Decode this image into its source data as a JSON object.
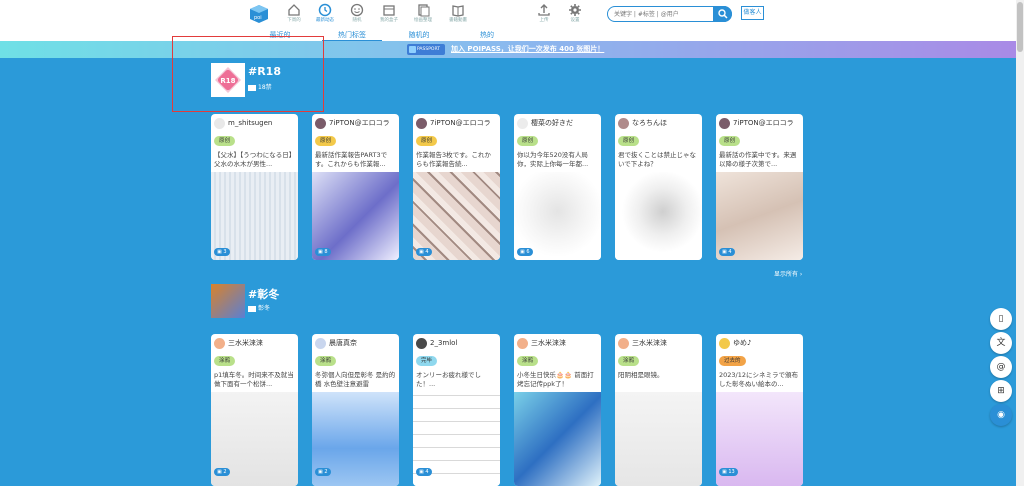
{
  "nav": {
    "items": [
      {
        "label": "下周的",
        "icon": "home-icon",
        "active": false
      },
      {
        "label": "最新动态",
        "icon": "clock-icon",
        "active": true
      },
      {
        "label": "随机",
        "icon": "smile-icon",
        "active": false
      },
      {
        "label": "我的盒子",
        "icon": "box-icon",
        "active": false
      },
      {
        "label": "绘画整理",
        "icon": "pages-icon",
        "active": false
      },
      {
        "label": "書籍動畫",
        "icon": "book-icon",
        "active": false
      },
      {
        "label": "上传",
        "icon": "upload-icon",
        "active": false
      },
      {
        "label": "设置",
        "icon": "gear-icon",
        "active": false
      }
    ],
    "search_placeholder": "关键字 | #标签 | @用户",
    "login_label": "做客人"
  },
  "tabs": [
    "最近的",
    "热门标签",
    "随机的",
    "热的"
  ],
  "banner": {
    "badge": "PASSPORT",
    "link": "加入 POIPASS，让我们一次发布 400 张图片！"
  },
  "sections": [
    {
      "title": "#R18",
      "sub": "18禁",
      "cards": [
        {
          "user": "m_shitsugen",
          "badge": "原创",
          "caption": "【父水】【うつわになる日】父水の水木が男性...",
          "count": "3"
        },
        {
          "user": "7iPTON@エロコラ",
          "badge": "原创",
          "caption": "最新話作業報告PART3です。これからも作業報...",
          "count": "8"
        },
        {
          "user": "7iPTON@エロコラ",
          "badge": "原创",
          "caption": "作業報告3枚です。これからも作業報告続...",
          "count": "4"
        },
        {
          "user": "樱菜の好きだ",
          "badge": "原创",
          "caption": "你以为今年520没有人局你，实际上你每一年都...",
          "count": "6"
        },
        {
          "user": "なろちんほ",
          "badge": "原创",
          "caption": "君で抜くことは禁止じゃないで下よね？",
          "count": ""
        },
        {
          "user": "7iPTON@エロコラ",
          "badge": "原创",
          "caption": "最新話の作業中です。来週以降の様子次第で...",
          "count": "4"
        }
      ]
    },
    {
      "title": "#彰冬",
      "sub": "彰冬",
      "cards": [
        {
          "user": "三水米涞涞",
          "badge": "涂鸦",
          "caption": "p1填车冬。时间来不及就当做下面有一个松饼...",
          "count": "2"
        },
        {
          "user": "晨唐真奈",
          "badge": "涂鸦",
          "caption": "冬弥個人向但是彰冬 是約的橋 水色壁注意避雷",
          "count": "2"
        },
        {
          "user": "2_3mlol",
          "badge": "完毕",
          "caption": "オンリーお疲れ様でした！...",
          "count": "4"
        },
        {
          "user": "三水米涞涞",
          "badge": "涂鸦",
          "caption": "小冬生日快乐🎂🎂 前面打烤忘记传ppk了！",
          "count": ""
        },
        {
          "user": "三水米涞涞",
          "badge": "涂鸦",
          "caption": "阳阴相是眼镜。",
          "count": ""
        },
        {
          "user": "ゆめ♪",
          "badge": "过去的",
          "caption": "2023/12にシネミラで頒布した彰冬ぬい絵本の...",
          "count": "13"
        }
      ]
    }
  ],
  "show_all": "显示所有 ›",
  "float_buttons": [
    "book-icon",
    "translate-icon",
    "at-icon",
    "grid-icon",
    "robot-icon"
  ],
  "colors": {
    "accent": "#2a8fd6",
    "page_bg": "#2b9ad9",
    "badge_green": "#b9e08a",
    "badge_yellow": "#f3c94a",
    "badge_blue": "#8fd8ee",
    "badge_orange": "#f2a347"
  }
}
